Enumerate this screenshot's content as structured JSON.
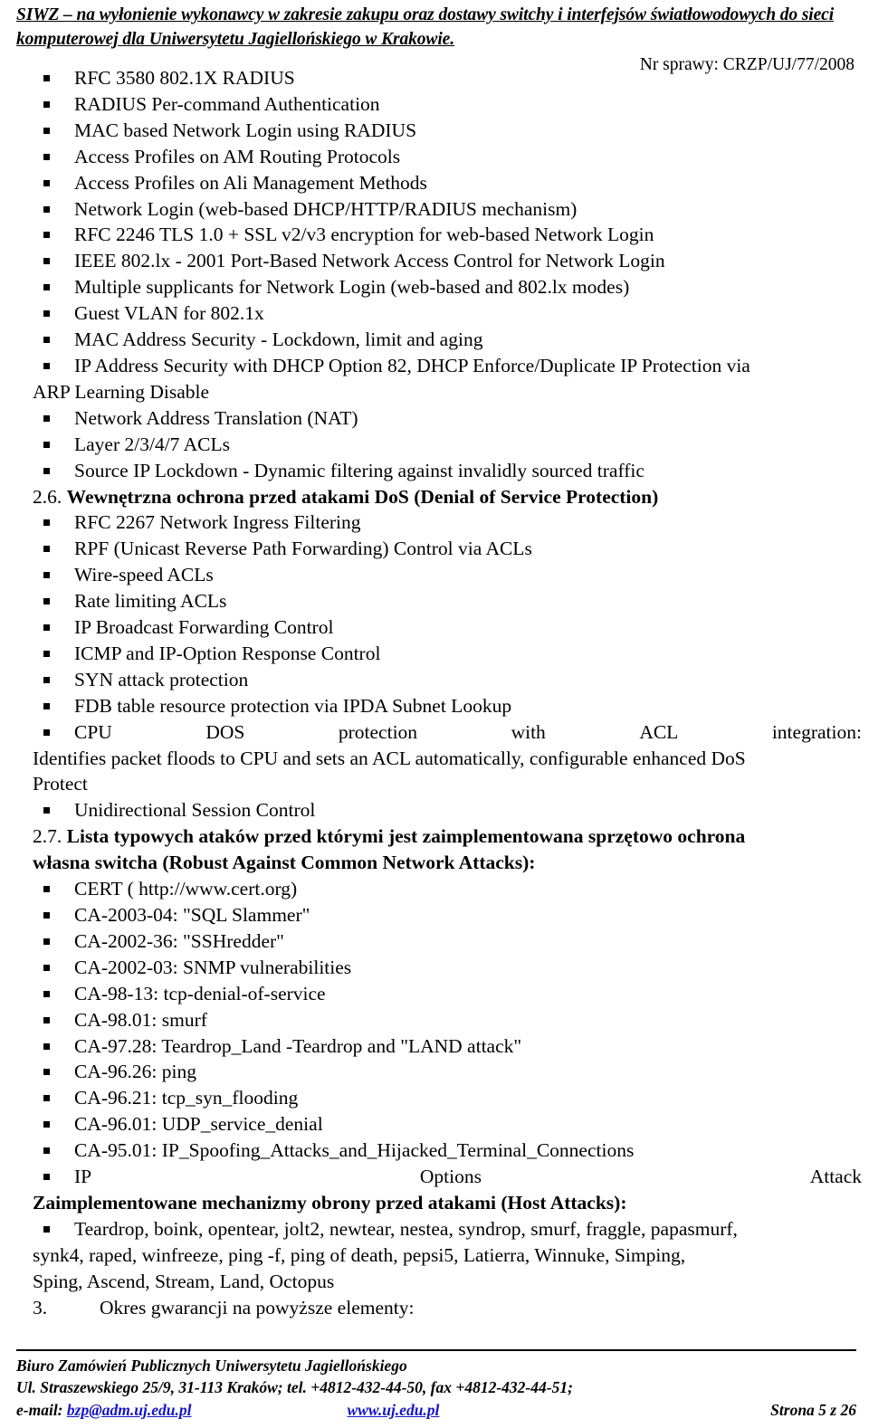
{
  "header": {
    "title": "SIWZ – na wyłonienie wykonawcy w zakresie zakupu oraz dostawy switchy i interfejsów światłowodowych do sieci komputerowej dla Uniwersytetu Jagiellońskiego w Krakowie.",
    "case_number": "Nr sprawy: CRZP/UJ/77/2008"
  },
  "body": {
    "security_bullets": [
      "RFC 3580 802.1X RADIUS",
      "RADIUS Per-command Authentication",
      "MAC based Network Login using RADIUS",
      "Access Profiles on AM Routing Protocols",
      "Access Profiles on Ali Management Methods",
      "Network Login (web-based DHCP/HTTP/RADIUS mechanism)",
      "RFC 2246 TLS 1.0 + SSL v2/v3 encryption for web-based Network Login",
      "IEEE 802.lx - 2001 Port-Based Network Access Control for Network Login",
      "Multiple supplicants for Network Login (web-based and 802.lx modes)",
      "Guest VLAN for 802.1x",
      "MAC Address Security - Lockdown, limit and aging"
    ],
    "ip_address_security": {
      "line1": "IP Address Security with DHCP Option 82, DHCP Enforce/Duplicate IP Protection via",
      "line2": "ARP Learning Disable"
    },
    "security_bullets_tail": [
      "Network Address Translation (NAT)",
      "Layer 2/3/4/7 ACLs",
      "Source IP Lockdown - Dynamic filtering against invalidly sourced traffic"
    ],
    "section_2_6": {
      "number": "2.6.",
      "title": "Wewnętrzna ochrona przed atakami DoS (Denial of Service Protection)"
    },
    "dos_bullets": [
      "RFC 2267 Network Ingress Filtering",
      "RPF (Unicast Reverse Path Forwarding) Control via ACLs",
      "Wire-speed ACLs",
      "Rate limiting ACLs",
      "IP Broadcast Forwarding Control",
      "ICMP and IP-Option Response Control",
      "SYN attack protection",
      "FDB table resource protection via IPDA Subnet Lookup"
    ],
    "cpu_dos": {
      "word1": "CPU",
      "word2": "DOS",
      "word3": "protection",
      "word4": "with",
      "word5": "ACL",
      "word6": "integration:",
      "line2": "Identifies packet floods to CPU and sets an ACL automatically, configurable enhanced DoS",
      "line3": "Protect"
    },
    "unidirectional_bullet": "Unidirectional Session Control",
    "section_2_7": {
      "number": "2.7.",
      "title_line1": "Lista typowych ataków przed którymi jest zaimplementowana sprzętowo ochrona",
      "title_line2": "własna switcha (Robust Against Common Network Attacks):"
    },
    "attack_bullets": [
      "CERT ( http://www.cert.org)",
      "CA-2003-04: \"SQL Slammer\"",
      "CA-2002-36: \"SSHredder\"",
      "CA-2002-03: SNMP vulnerabilities",
      "CA-98-13: tcp-denial-of-service",
      "CA-98.01: smurf",
      "CA-97.28: Teardrop_Land -Teardrop and \"LAND attack\"",
      "CA-96.26: ping",
      "CA-96.21: tcp_syn_flooding",
      "CA-96.01: UDP_service_denial",
      "CA-95.01: IP_Spoofing_Attacks_and_Hijacked_Terminal_Connections"
    ],
    "ip_options_attack": {
      "word1": "IP",
      "word2": "Options",
      "word3": "Attack"
    },
    "host_attacks_heading": "Zaimplementowane mechanizmy obrony przed atakami (Host Attacks):",
    "host_attacks_list": {
      "line1": "Teardrop, boink, opentear, jolt2, newtear, nestea, syndrop, smurf, fraggle, papasmurf,",
      "line2": "synk4, raped, winfreeze, ping -f, ping of death, pepsi5, Latierra, Winnuke, Simping,",
      "line3": "Sping, Ascend, Stream, Land, Octopus"
    },
    "warranty_item": {
      "number": "3.",
      "text": "Okres gwarancji na powyższe elementy:"
    }
  },
  "footer": {
    "line1": "Biuro Zamówień Publicznych Uniwersytetu Jagiellońskiego",
    "line2": "Ul. Straszewskiego 25/9, 31-113 Kraków; tel. +4812-432-44-50, fax +4812-432-44-51;",
    "email_label": "e-mail: ",
    "email": "bzp@adm.uj.edu.pl",
    "website": "www.uj.edu.pl",
    "page_label": "Strona 5 z 26"
  },
  "colors": {
    "link": "#1414c8",
    "text": "#000000",
    "background": "#ffffff"
  }
}
